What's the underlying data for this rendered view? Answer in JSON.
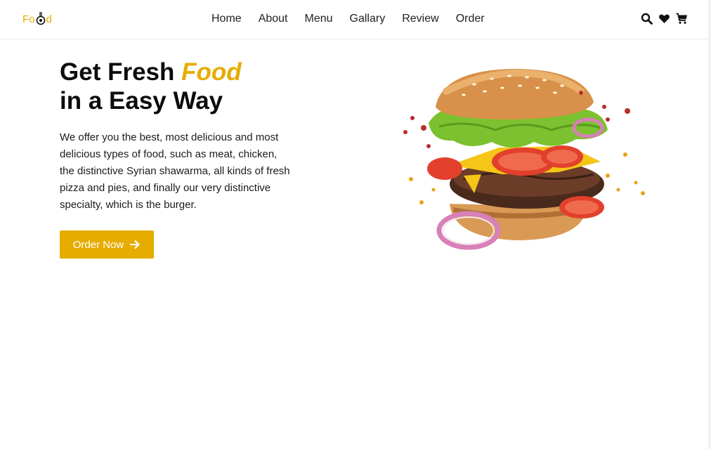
{
  "header": {
    "logo": {
      "before": "Fo",
      "after": "d"
    },
    "nav": [
      {
        "label": "Home"
      },
      {
        "label": "About"
      },
      {
        "label": "Menu"
      },
      {
        "label": "Gallary"
      },
      {
        "label": "Review"
      },
      {
        "label": "Order"
      }
    ],
    "icons": [
      "search-icon",
      "heart-icon",
      "cart-icon"
    ]
  },
  "hero": {
    "title_line1": "Get Fresh ",
    "title_accent": "Food",
    "title_line2": "in a Easy Way",
    "description": "We offer you the best, most delicious and most delicious types of food, such as meat, chicken, the distinctive Syrian shawarma, all kinds of fresh pizza and pies, and finally our very distinctive specialty, which is the burger.",
    "button_label": "Order Now"
  },
  "colors": {
    "accent": "#e6ac00",
    "text": "#111111",
    "background": "#ffffff"
  }
}
